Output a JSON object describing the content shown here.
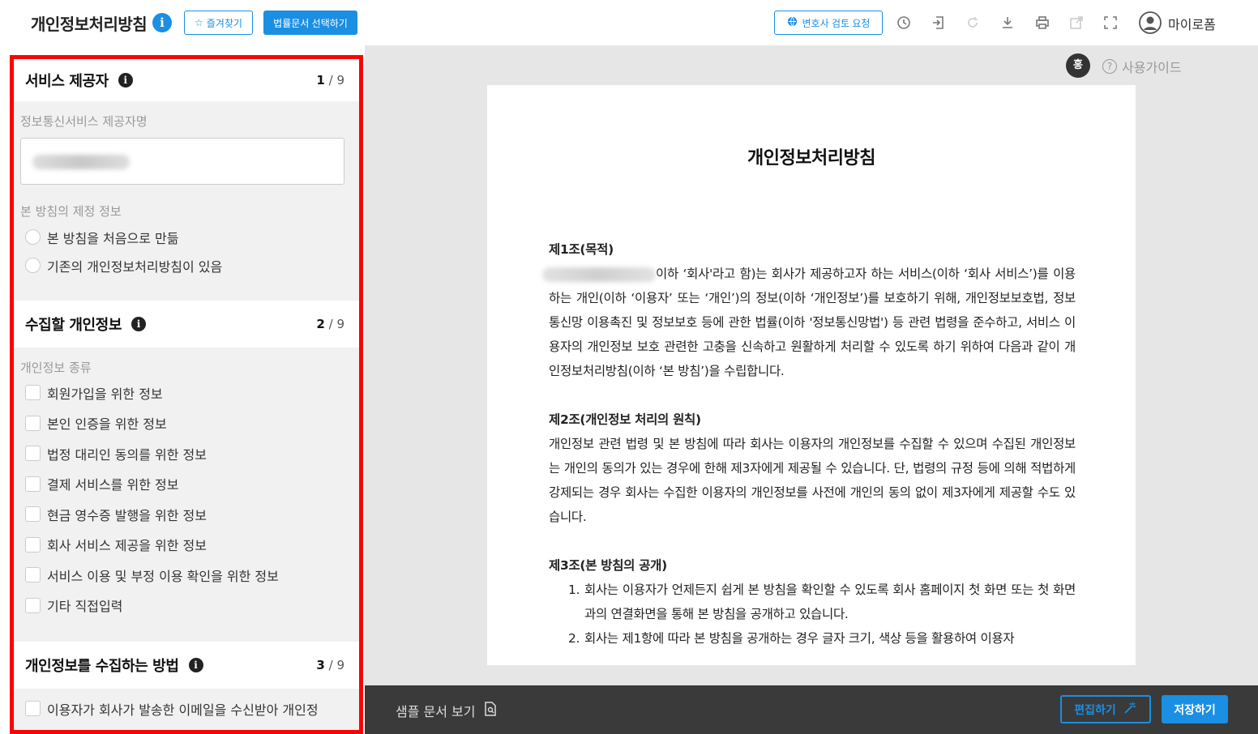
{
  "header": {
    "title": "개인정보처리방침",
    "favorite_label": "즐겨찾기",
    "legal_doc_label": "법률문서 선택하기",
    "lawyer_review_label": "변호사 검토 요청",
    "user_name": "마이로폼"
  },
  "preview_meta": {
    "user_badge": "홍",
    "guide_label": "사용가이드"
  },
  "sections": {
    "s1": {
      "title": "서비스 제공자",
      "step_current": "1",
      "step_total": "/ 9",
      "provider_label": "정보통신서비스 제공자명",
      "policy_label": "본 방침의 제정 정보",
      "options": [
        "본 방침을 처음으로 만듦",
        "기존의 개인정보처리방침이 있음"
      ]
    },
    "s2": {
      "title": "수집할 개인정보",
      "step_current": "2",
      "step_total": "/ 9",
      "kind_label": "개인정보 종류",
      "options": [
        "회원가입을 위한 정보",
        "본인 인증을 위한 정보",
        "법정 대리인 동의를 위한 정보",
        "결제 서비스를 위한 정보",
        "현금 영수증 발행을 위한 정보",
        "회사 서비스 제공을 위한 정보",
        "서비스 이용 및 부정 이용 확인을 위한 정보",
        "기타 직접입력"
      ]
    },
    "s3": {
      "title": "개인정보를 수집하는 방법",
      "step_current": "3",
      "step_total": "/ 9",
      "options": [
        "이용자가 회사가 발송한 이메일을 수신받아 개인정"
      ]
    }
  },
  "document": {
    "title": "개인정보처리방침",
    "a1_heading": "제1조(목적)",
    "a1_text": "이하 ‘회사'라고 함)는 회사가 제공하고자 하는 서비스(이하 ‘회사 서비스’)를 이용하는 개인(이하 ‘이용자’ 또는 ‘개인’)의 정보(이하 ‘개인정보’)를 보호하기 위해, 개인정보보호법, 정보통신망 이용촉진 및 정보보호 등에 관한 법률(이하 '정보통신망법') 등 관련 법령을 준수하고, 서비스 이용자의 개인정보 보호 관련한 고충을 신속하고 원활하게 처리할 수 있도록 하기 위하여 다음과 같이 개인정보처리방침(이하 ‘본 방침’)을 수립합니다.",
    "a2_heading": "제2조(개인정보 처리의 원칙)",
    "a2_text": "개인정보 관련 법령 및 본 방침에 따라 회사는 이용자의 개인정보를 수집할 수 있으며 수집된 개인정보는 개인의 동의가 있는 경우에 한해 제3자에게 제공될 수 있습니다. 단, 법령의 규정 등에 의해 적법하게 강제되는 경우 회사는 수집한 이용자의 개인정보를 사전에 개인의 동의 없이 제3자에게 제공할 수도 있습니다.",
    "a3_heading": "제3조(본 방침의 공개)",
    "a3_items": [
      {
        "num": "1.",
        "text": "회사는 이용자가 언제든지 쉽게 본 방침을 확인할 수 있도록 회사 홈페이지 첫 화면 또는 첫 화면과의 연결화면을 통해 본 방침을 공개하고 있습니다."
      },
      {
        "num": "2.",
        "text": "회사는 제1항에 따라 본 방침을 공개하는 경우 글자 크기, 색상 등을 활용하여 이용자"
      }
    ]
  },
  "footer": {
    "sample_label": "샘플 문서 보기",
    "edit_label": "편집하기",
    "save_label": "저장하기"
  },
  "colors": {
    "accent": "#1a8fe3",
    "highlight_border": "#ff0000",
    "bottom_bar": "#3a3a3a"
  }
}
